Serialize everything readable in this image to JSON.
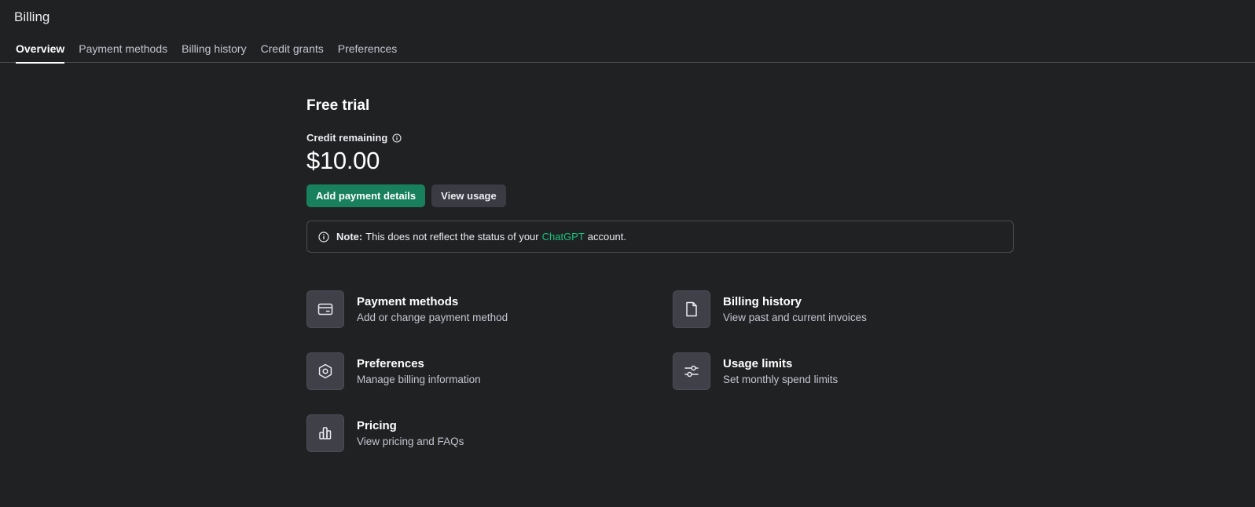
{
  "header": {
    "title": "Billing"
  },
  "tabs": [
    {
      "label": "Overview",
      "active": true
    },
    {
      "label": "Payment methods",
      "active": false
    },
    {
      "label": "Billing history",
      "active": false
    },
    {
      "label": "Credit grants",
      "active": false
    },
    {
      "label": "Preferences",
      "active": false
    }
  ],
  "plan": {
    "name": "Free trial",
    "credit_label": "Credit remaining",
    "credit_amount": "$10.00"
  },
  "actions": {
    "add_payment": "Add payment details",
    "view_usage": "View usage"
  },
  "note": {
    "prefix": "Note:",
    "text_before": "This does not reflect the status of your",
    "link": "ChatGPT",
    "text_after": "account."
  },
  "cards": [
    {
      "icon": "credit-card-icon",
      "title": "Payment methods",
      "desc": "Add or change payment method"
    },
    {
      "icon": "document-icon",
      "title": "Billing history",
      "desc": "View past and current invoices"
    },
    {
      "icon": "gear-icon",
      "title": "Preferences",
      "desc": "Manage billing information"
    },
    {
      "icon": "sliders-icon",
      "title": "Usage limits",
      "desc": "Set monthly spend limits"
    },
    {
      "icon": "bar-chart-icon",
      "title": "Pricing",
      "desc": "View pricing and FAQs"
    }
  ],
  "colors": {
    "background": "#202123",
    "accent": "#19805e",
    "link": "#19c37d",
    "border": "#4d4d4f"
  }
}
